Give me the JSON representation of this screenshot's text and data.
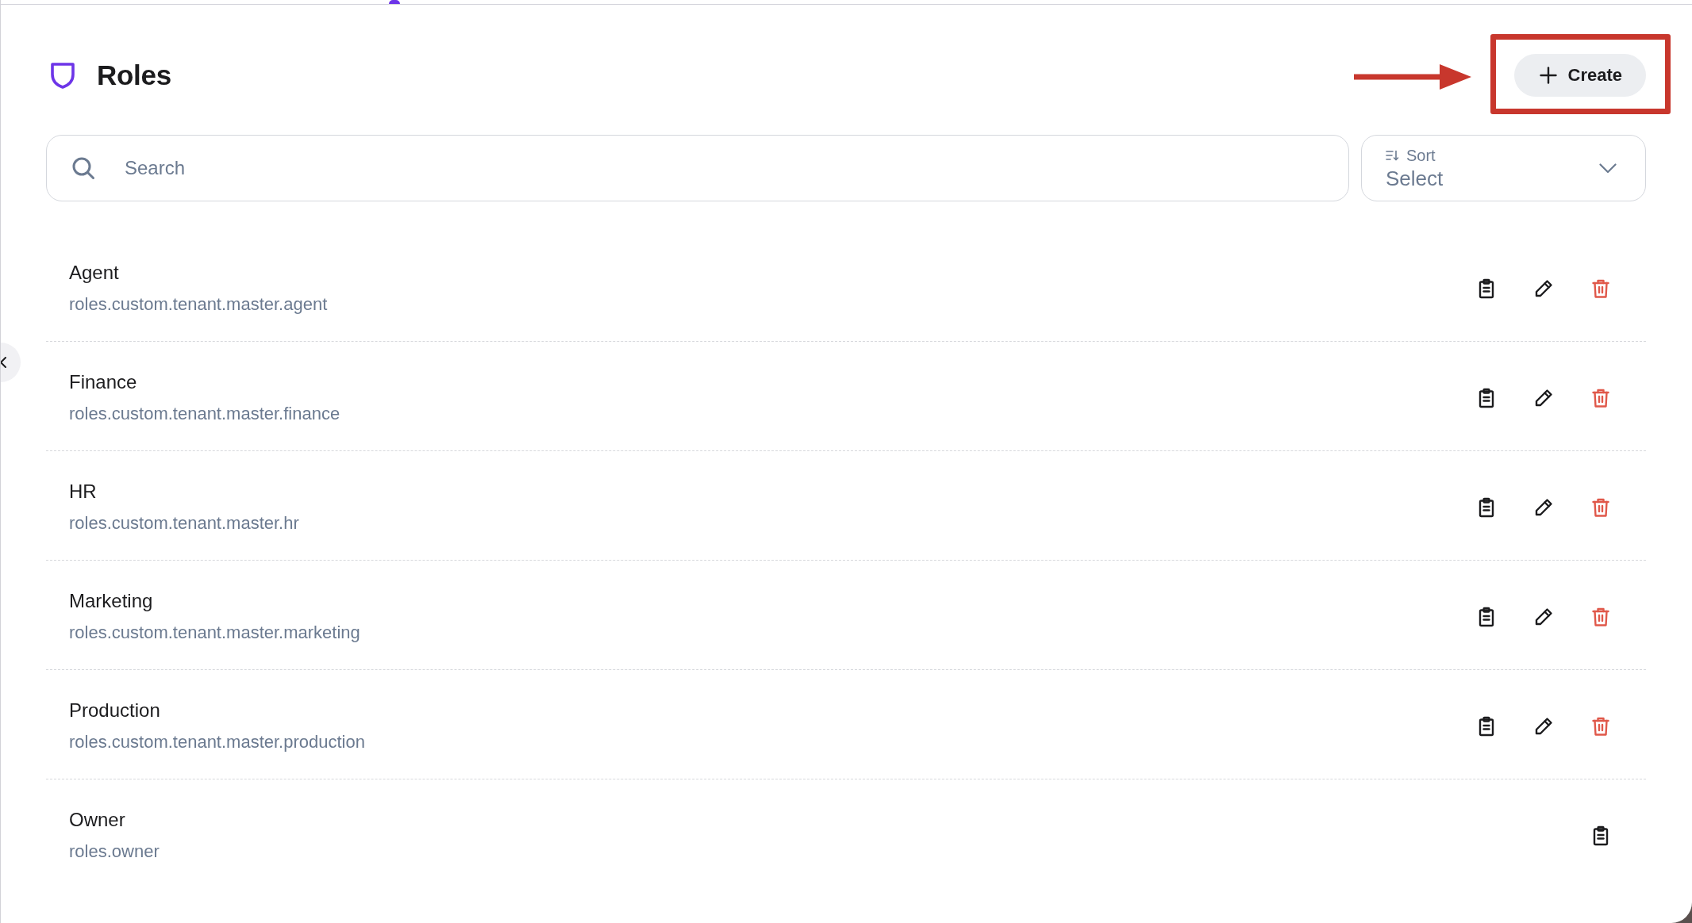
{
  "header": {
    "title": "Roles",
    "create_button": {
      "label": "Create"
    }
  },
  "search": {
    "placeholder": "Search"
  },
  "sort": {
    "label": "Sort",
    "value": "Select"
  },
  "roles": [
    {
      "name": "Agent",
      "key": "roles.custom.tenant.master.agent",
      "editable": true,
      "deletable": true
    },
    {
      "name": "Finance",
      "key": "roles.custom.tenant.master.finance",
      "editable": true,
      "deletable": true
    },
    {
      "name": "HR",
      "key": "roles.custom.tenant.master.hr",
      "editable": true,
      "deletable": true
    },
    {
      "name": "Marketing",
      "key": "roles.custom.tenant.master.marketing",
      "editable": true,
      "deletable": true
    },
    {
      "name": "Production",
      "key": "roles.custom.tenant.master.production",
      "editable": true,
      "deletable": true
    },
    {
      "name": "Owner",
      "key": "roles.owner",
      "editable": false,
      "deletable": false
    }
  ]
}
